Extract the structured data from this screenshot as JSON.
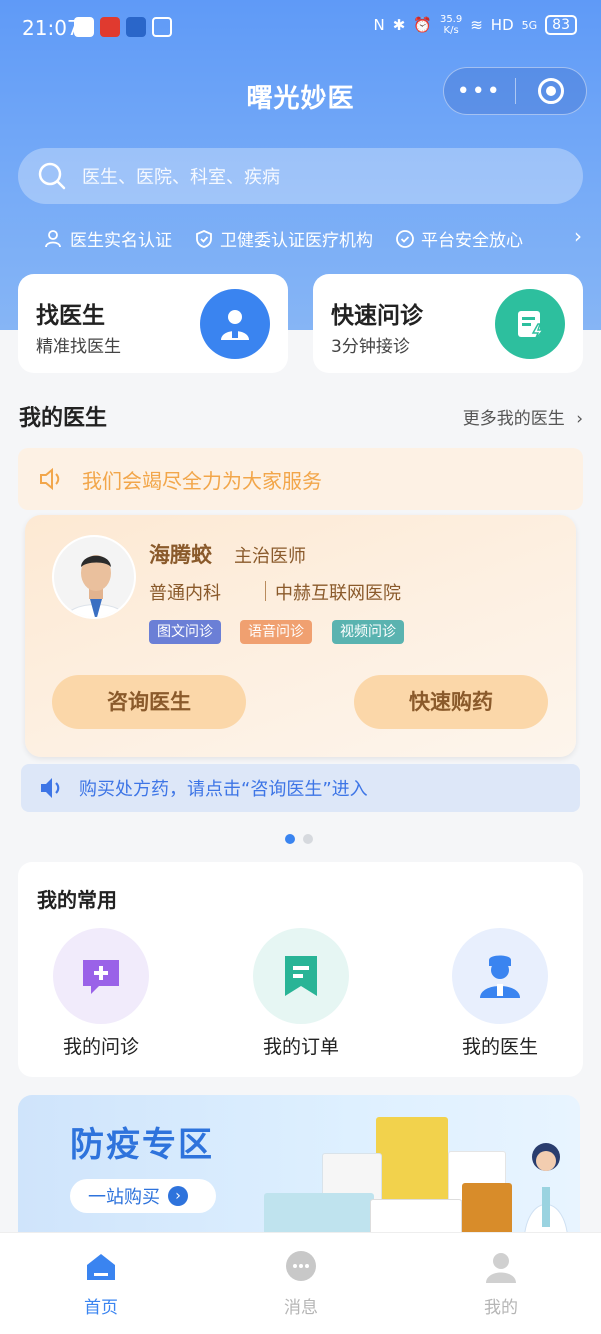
{
  "status_bar": {
    "time": "21:07",
    "speed_top": "35.9",
    "speed_unit": "K/s",
    "network": "HD",
    "signal": "5G",
    "battery": "83"
  },
  "header": {
    "title": "曙光妙医",
    "capsule_more": "•••"
  },
  "search": {
    "placeholder": "医生、医院、科室、疾病"
  },
  "badges": [
    {
      "label": "医生实名认证",
      "icon": "user-verified-icon"
    },
    {
      "label": "卫健委认证医疗机构",
      "icon": "shield-check-icon"
    },
    {
      "label": "平台安全放心",
      "icon": "check-circle-icon"
    }
  ],
  "cards": {
    "find_doctor": {
      "title": "找医生",
      "subtitle": "精准找医生",
      "color": "#3a84f0"
    },
    "quick_consult": {
      "title": "快速问诊",
      "subtitle": "3分钟接诊",
      "color": "#2dbf9e"
    }
  },
  "my_doctor": {
    "title": "我的医生",
    "more": "更多我的医生",
    "notice": "我们会竭尽全力为大家服务",
    "doctor": {
      "name": "海腾蛟",
      "title": "主治医师",
      "dept": "普通内科",
      "hospital": "中赫互联网医院",
      "tags": [
        {
          "label": "图文问诊",
          "color": "#6b7fd6"
        },
        {
          "label": "语音问诊",
          "color": "#f0a070"
        },
        {
          "label": "视频问诊",
          "color": "#5ab3b0"
        }
      ],
      "btn_consult": "咨询医生",
      "btn_buy": "快速购药"
    },
    "tip": "购买处方药，请点击“咨询医生”进入"
  },
  "common": {
    "title": "我的常用",
    "items": [
      {
        "label": "我的问诊",
        "icon": "chat-plus-icon"
      },
      {
        "label": "我的订单",
        "icon": "bookmark-icon"
      },
      {
        "label": "我的医生",
        "icon": "doctor-icon"
      }
    ]
  },
  "banner": {
    "title": "防疫专区",
    "button": "一站购买"
  },
  "tabbar": [
    {
      "label": "首页",
      "active": true
    },
    {
      "label": "消息",
      "active": false
    },
    {
      "label": "我的",
      "active": false
    }
  ],
  "colors": {
    "primary": "#3a84f0",
    "accent_orange": "#f2a64a",
    "doctor_brown": "#8a5a2b"
  }
}
